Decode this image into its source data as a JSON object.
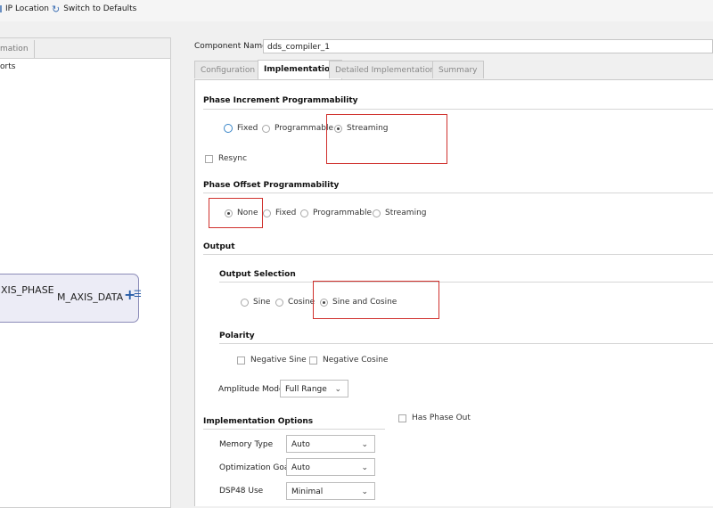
{
  "toolbar": {
    "ip_location": "IP Location",
    "switch_defaults": "Switch to Defaults"
  },
  "left": {
    "tab_label": "mation",
    "tree_item": "orts",
    "block_port_in": "XIS_PHASE",
    "block_port_out": "M_AXIS_DATA"
  },
  "component": {
    "label": "Component Name",
    "value": "dds_compiler_1"
  },
  "tabs": [
    "Configuration",
    "Implementation",
    "Detailed Implementation",
    "Summary"
  ],
  "phase_increment": {
    "title": "Phase Increment Programmability",
    "options": [
      "Fixed",
      "Programmable",
      "Streaming"
    ],
    "selected": "Streaming",
    "resync": "Resync"
  },
  "phase_offset": {
    "title": "Phase Offset Programmability",
    "options": [
      "None",
      "Fixed",
      "Programmable",
      "Streaming"
    ],
    "selected": "None"
  },
  "output": {
    "title": "Output",
    "selection_title": "Output Selection",
    "options": [
      "Sine",
      "Cosine",
      "Sine and Cosine"
    ],
    "selected": "Sine and Cosine",
    "polarity_title": "Polarity",
    "negative_sine": "Negative Sine",
    "negative_cosine": "Negative Cosine",
    "amplitude_label": "Amplitude Mode",
    "amplitude_value": "Full Range"
  },
  "impl": {
    "title": "Implementation Options",
    "has_phase_out": "Has Phase Out",
    "memory_type_label": "Memory Type",
    "memory_type_value": "Auto",
    "opt_goal_label": "Optimization Goal",
    "opt_goal_value": "Auto",
    "dsp48_label": "DSP48 Use",
    "dsp48_value": "Minimal"
  },
  "colors": {
    "highlight": "#d0312d",
    "focus_radio": "#3a86c8",
    "plus": "#2a5ea8"
  }
}
